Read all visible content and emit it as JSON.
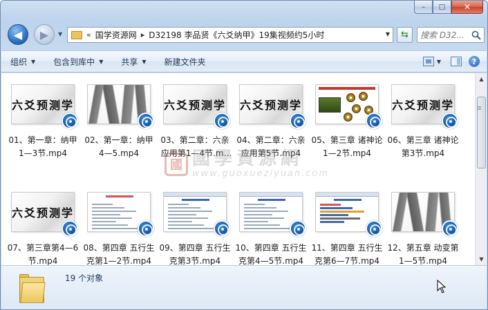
{
  "window": {
    "controls": {
      "minimize_symbol": "–",
      "maximize_symbol": "□",
      "close_symbol": "✕"
    }
  },
  "nav": {
    "back_symbol": "◀",
    "forward_symbol": "▶",
    "address": {
      "overflow_symbol": "«",
      "separator_symbol": "▸",
      "crumbs": [
        "国学资源网",
        "D32198 李品贤《六爻纳甲》19集视频约5小时"
      ],
      "dropdown_symbol": "▼"
    },
    "refresh_symbol": "⇆",
    "search": {
      "placeholder": "搜索 D32..."
    }
  },
  "toolbar": {
    "items": [
      {
        "label": "组织",
        "has_dropdown": true
      },
      {
        "label": "包含到库中",
        "has_dropdown": true
      },
      {
        "label": "共享",
        "has_dropdown": true
      },
      {
        "label": "新建文件夹",
        "has_dropdown": false
      }
    ],
    "dropdown_symbol": "▼",
    "help_symbol": "?"
  },
  "files": [
    {
      "name": "01、第一章：纳甲1—3节.mp4",
      "thumb": "title"
    },
    {
      "name": "02、第一章：纳甲4—5.mp4",
      "thumb": "brush"
    },
    {
      "name": "03、第二章：六亲应用第1—4节.mp4",
      "thumb": "title"
    },
    {
      "name": "04、第二章：六亲应用第5节.mp4",
      "thumb": "title"
    },
    {
      "name": "05、第三章 诸神论1—2节.mp4",
      "thumb": "coins"
    },
    {
      "name": "06、第三章 诸神论第3节.mp4",
      "thumb": "title"
    },
    {
      "name": "07、第三章第4—6节.mp4",
      "thumb": "title"
    },
    {
      "name": "08、第四章 五行生克第1—2节.mp4",
      "thumb": "slide-red"
    },
    {
      "name": "09、第四章 五行生克第3节.mp4",
      "thumb": "slide-blue"
    },
    {
      "name": "10、第四章 五行生克第4—5节.mp4",
      "thumb": "slide-blue"
    },
    {
      "name": "11、第四章  五行生克第6—7节.mp4",
      "thumb": "slide-lines"
    },
    {
      "name": "12、第五章 动变第1—5节.mp4",
      "thumb": "brush"
    }
  ],
  "thumb_title_text": "六爻预测学",
  "scrollbar": {
    "up_symbol": "▲",
    "down_symbol": "▼"
  },
  "details": {
    "count_text": "19 个对象"
  },
  "colors": {
    "accent": "#1e395b",
    "badge": "#0f4f9c",
    "close": "#c7412a"
  }
}
